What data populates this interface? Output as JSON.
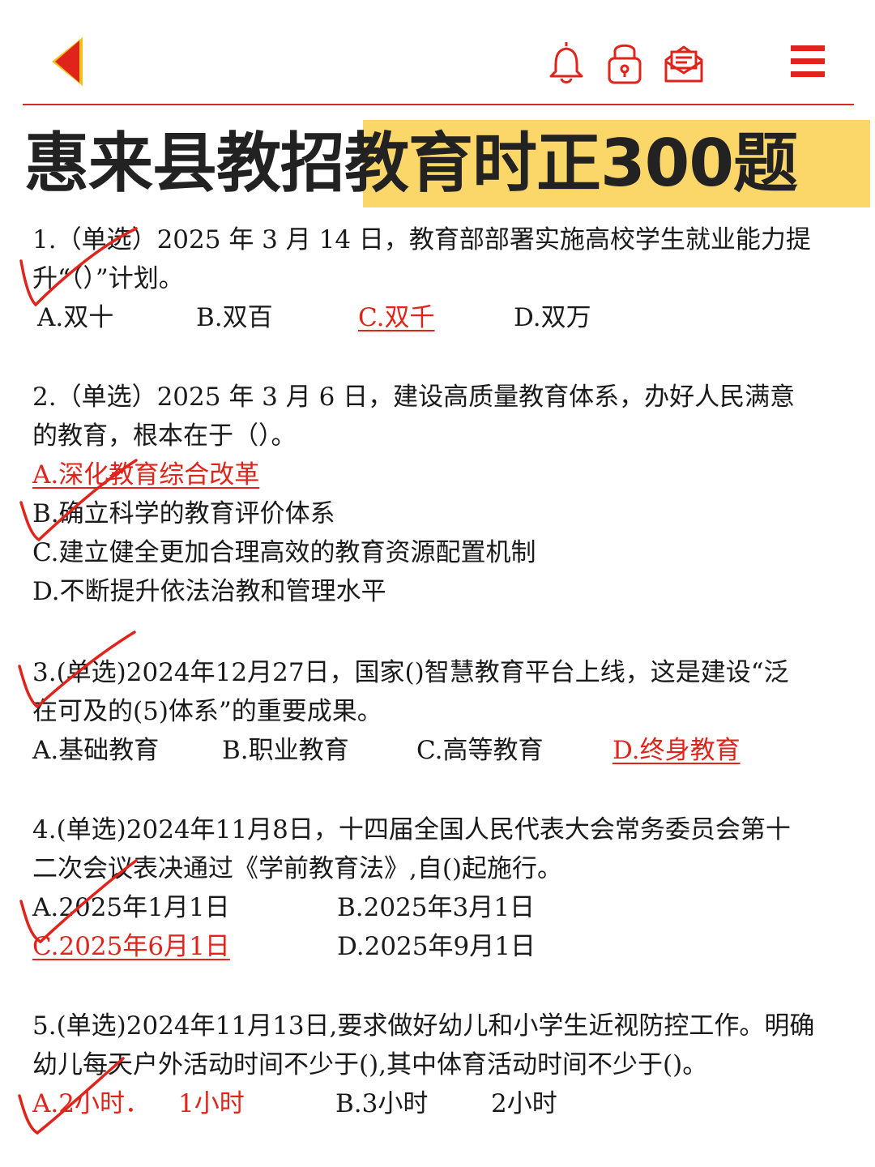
{
  "icons": {
    "back": "back-arrow-icon",
    "bell": "bell-icon",
    "lock": "lock-icon",
    "mail": "mail-icon",
    "menu": "menu-icon"
  },
  "colors": {
    "accent": "#e0241b",
    "highlight": "#fbd76a",
    "title": "#222222"
  },
  "title": "惠来县教招教育时正300题",
  "questions": [
    {
      "lines": [
        "1.（单选）2025 年 3 月 14 日，教育部部署实施高校学生就业能力提",
        "升“（）”计划。"
      ],
      "options": [
        "A.双十",
        "B.双百",
        "C.双千",
        "D.双万"
      ],
      "answer": "C"
    },
    {
      "lines": [
        " 2.（单选）2025 年 3 月 6 日，建设高质量教育体系，办好人民满意",
        "的教育，根本在于（）。"
      ],
      "options": [
        "A.深化教育综合改革",
        "B.确立科学的教育评价体系",
        "C.建立健全更加合理高效的教育资源配置机制",
        "D.不断提升依法治教和管理水平"
      ],
      "answer": "A"
    },
    {
      "lines": [
        "3.(单选)2024年12月27日，国家()智慧教育平台上线，这是建设“泛",
        "在可及的(5)体系”的重要成果。"
      ],
      "options": [
        "A.基础教育",
        "B.职业教育",
        "C.高等教育",
        "D.终身教育"
      ],
      "answer": "D"
    },
    {
      "lines": [
        "4.(单选)2024年11月8日，十四届全国人民代表大会常务委员会第十",
        "二次会议表决通过《学前教育法》,自()起施行。"
      ],
      "options": [
        "A.2025年1月1日",
        "B.2025年3月1日",
        "C.2025年6月1日",
        "D.2025年9月1日"
      ],
      "answer": "C"
    },
    {
      "lines": [
        "5.(单选)2024年11月13日,要求做好幼儿和小学生近视防控工作。明确",
        "幼儿每天户外活动时间不少于(),其中体育活动时间不少于()。"
      ],
      "options": [
        "A.2小时．",
        "1小时",
        "B.3小时",
        "2小时"
      ],
      "answer": "A"
    }
  ]
}
